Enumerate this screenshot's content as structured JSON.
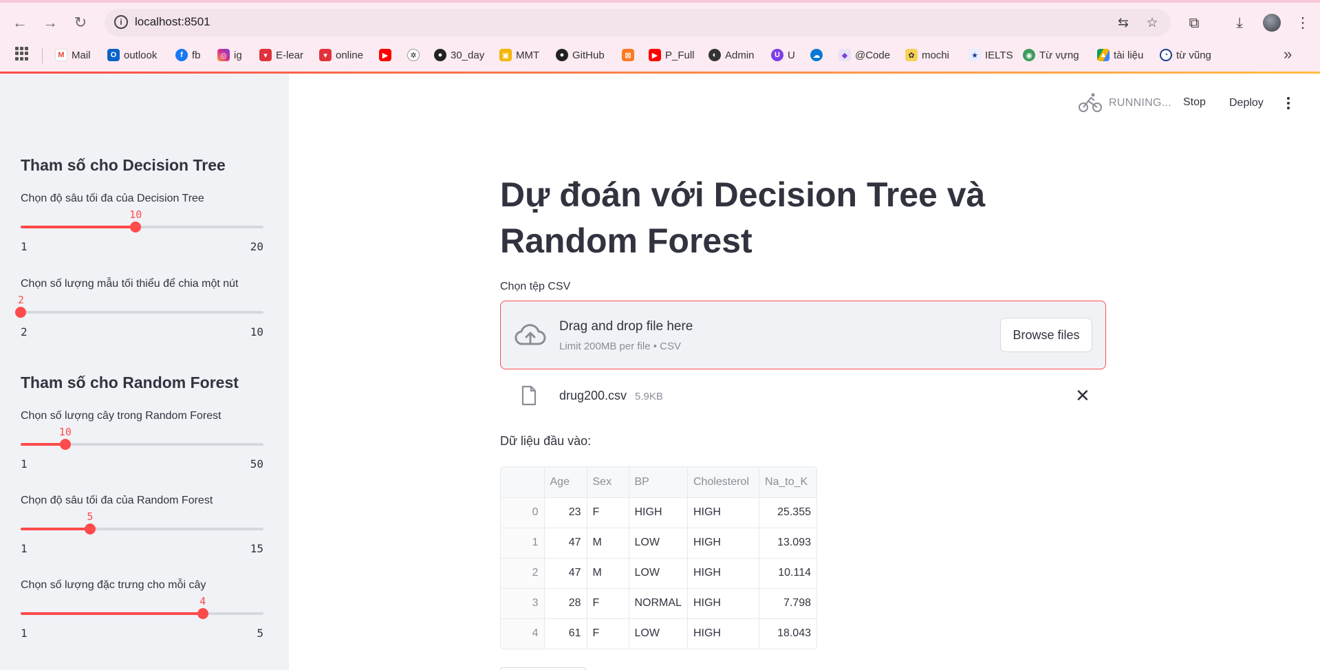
{
  "browser": {
    "url": "localhost:8501",
    "bookmarks": [
      "Mail",
      "outlook",
      "fb",
      "ig",
      "E-lear",
      "online",
      "",
      "",
      "30_day",
      "MMT",
      "GitHub",
      "",
      "P_Full",
      "Admin",
      "U",
      "",
      "@Code",
      "mochi",
      "IELTS",
      "Từ vựng",
      "tài liệu",
      "từ vũng"
    ]
  },
  "status": {
    "running": "RUNNING...",
    "stop": "Stop",
    "deploy": "Deploy"
  },
  "sidebar": {
    "dt_heading": "Tham số cho Decision Tree",
    "rf_heading": "Tham số cho Random Forest",
    "sliders": [
      {
        "label": "Chọn độ sâu tối đa của Decision Tree",
        "value": "10",
        "min": "1",
        "max": "20"
      },
      {
        "label": "Chọn số lượng mẫu tối thiểu để chia một nút",
        "value": "2",
        "min": "2",
        "max": "10"
      },
      {
        "label": "Chọn số lượng cây trong Random Forest",
        "value": "10",
        "min": "1",
        "max": "50"
      },
      {
        "label": "Chọn độ sâu tối đa của Random Forest",
        "value": "5",
        "min": "1",
        "max": "15"
      },
      {
        "label": "Chọn số lượng đặc trưng cho mỗi cây",
        "value": "4",
        "min": "1",
        "max": "5"
      }
    ]
  },
  "main": {
    "title": "Dự đoán với Decision Tree và Random Forest",
    "uploader_label": "Chọn tệp CSV",
    "dropzone_title": "Drag and drop file here",
    "dropzone_sub": "Limit 200MB per file • CSV",
    "browse": "Browse files",
    "file_name": "drug200.csv",
    "file_size": "5.9KB",
    "data_label": "Dữ liệu đầu vào:",
    "table": {
      "columns": [
        "",
        "Age",
        "Sex",
        "BP",
        "Cholesterol",
        "Na_to_K"
      ],
      "rows": [
        [
          "0",
          "23",
          "F",
          "HIGH",
          "HIGH",
          "25.355"
        ],
        [
          "1",
          "47",
          "M",
          "LOW",
          "HIGH",
          "13.093"
        ],
        [
          "2",
          "47",
          "M",
          "LOW",
          "HIGH",
          "10.114"
        ],
        [
          "3",
          "28",
          "F",
          "NORMAL",
          "HIGH",
          "7.798"
        ],
        [
          "4",
          "61",
          "F",
          "LOW",
          "HIGH",
          "18.043"
        ]
      ]
    }
  },
  "colors": {
    "accent": "#ff4b4b",
    "sidebar_bg": "#f0f2f6",
    "text": "#31333f",
    "muted": "#8b8d97"
  },
  "icons": [
    "back-icon",
    "forward-icon",
    "reload-icon",
    "info-icon",
    "translate-icon",
    "star-icon",
    "extensions-icon",
    "download-icon",
    "profile-avatar",
    "apps-icon",
    "running-icon",
    "kebab-menu-icon",
    "cloud-upload-icon",
    "file-icon",
    "close-icon"
  ]
}
